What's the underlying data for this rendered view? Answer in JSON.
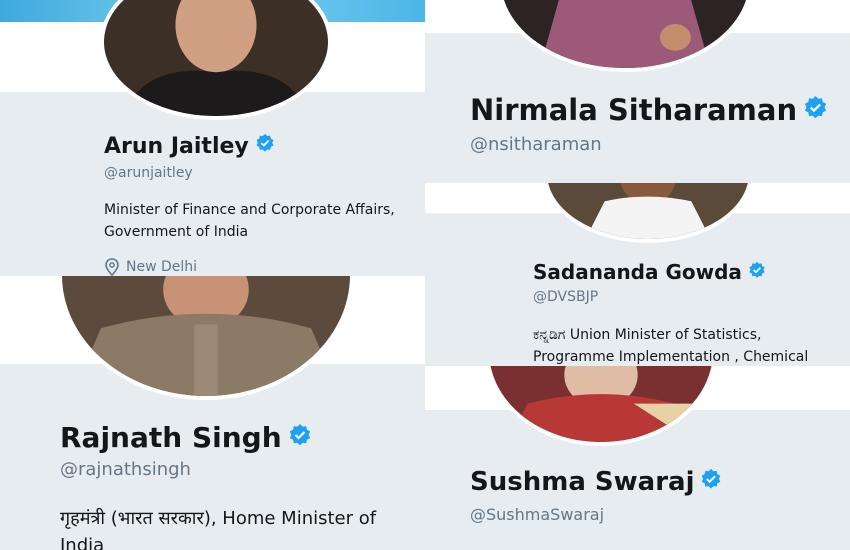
{
  "profiles": [
    {
      "name": "Arun Jaitley",
      "handle": "@arunjaitley",
      "bio": "Minister of Finance and Corporate Affairs, Government of India",
      "location": "New Delhi",
      "verified": true
    },
    {
      "name": "Nirmala Sitharaman",
      "handle": "@nsitharaman",
      "verified": true
    },
    {
      "name": "Sadananda Gowda",
      "handle": "@DVSBJP",
      "bio": "ಕನ್ನಡಿಗ Union Minister of Statistics, Programme Implementation , Chemical",
      "verified": true
    },
    {
      "name": "Rajnath Singh",
      "handle": "@rajnathsingh",
      "bio": "गृहमंत्री (भारत सरकार), Home Minister of India",
      "verified": true
    },
    {
      "name": "Sushma Swaraj",
      "handle": "@SushmaSwaraj",
      "verified": true
    }
  ],
  "colors": {
    "card_bg": "#e6ecf0",
    "verified_blue": "#1da1f2",
    "handle_gray": "#657786",
    "text_dark": "#14171a"
  }
}
